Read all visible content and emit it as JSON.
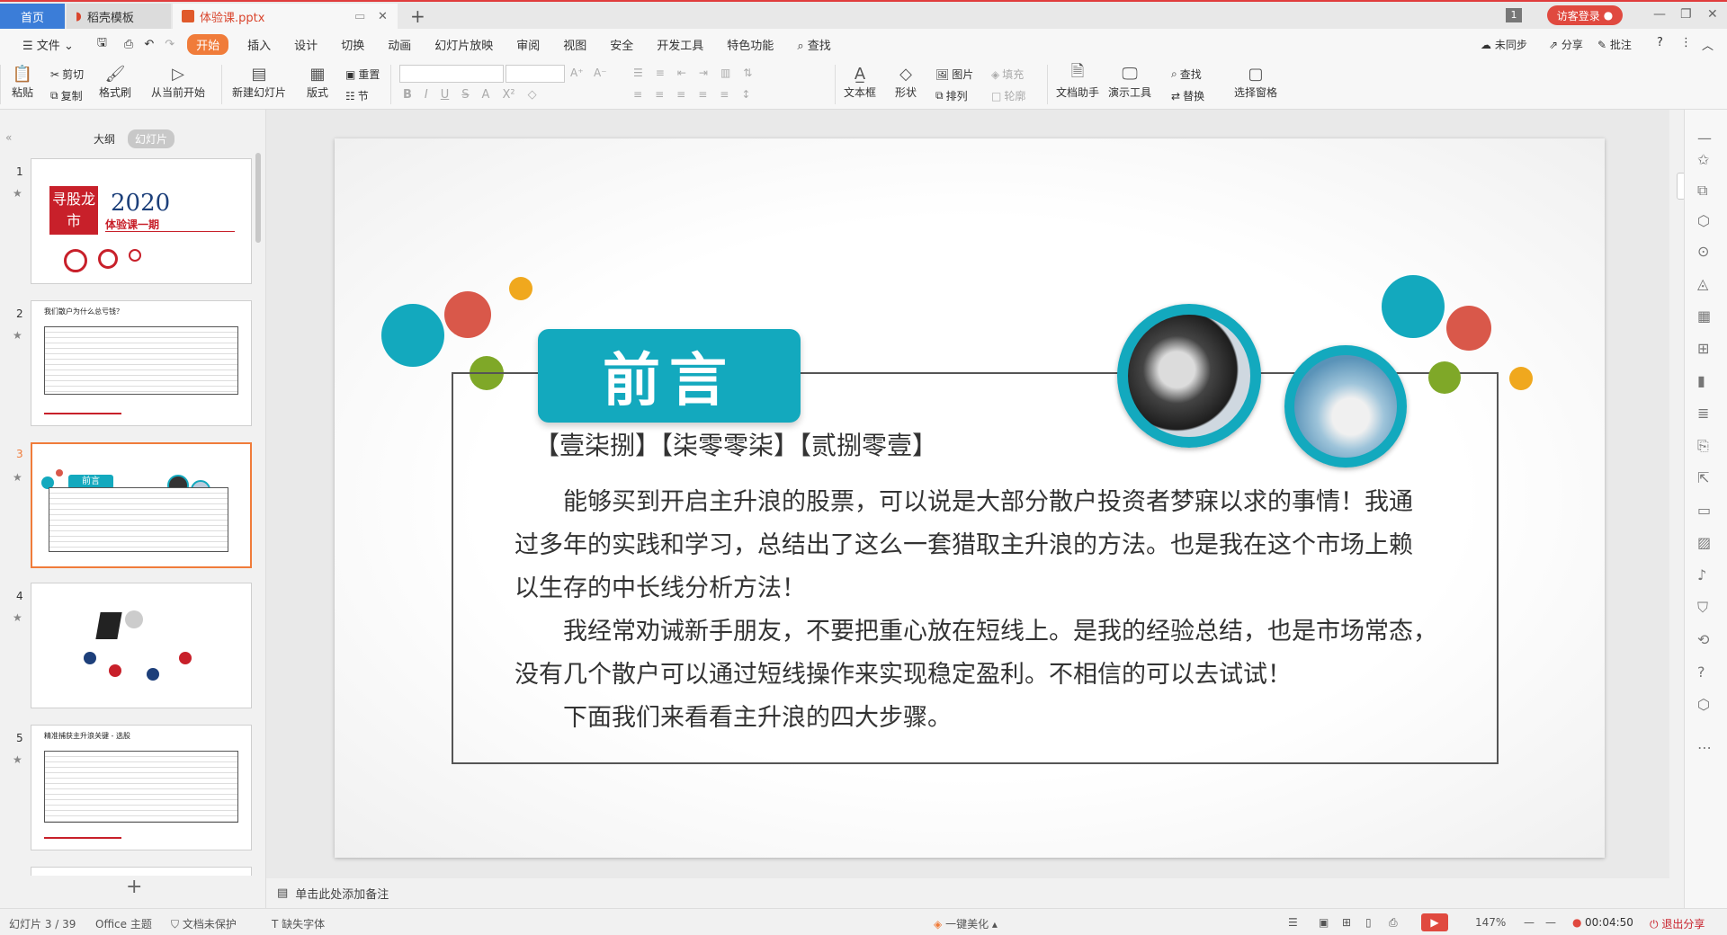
{
  "tabs": {
    "home": "首页",
    "docer": "稻壳模板",
    "file": "体验课.pptx"
  },
  "titlebar": {
    "badge": "1",
    "login": "访客登录"
  },
  "menu": {
    "file": "文件",
    "items": [
      "开始",
      "插入",
      "设计",
      "切换",
      "动画",
      "幻灯片放映",
      "审阅",
      "视图",
      "安全",
      "开发工具",
      "特色功能"
    ],
    "search": "查找",
    "sync": "未同步",
    "share": "分享",
    "comment": "批注"
  },
  "ribbon": {
    "paste": "粘贴",
    "cut": "剪切",
    "copy": "复制",
    "format_painter": "格式刷",
    "from_current": "从当前开始",
    "new_slide": "新建幻灯片",
    "layout": "版式",
    "reset": "重置",
    "section": "节",
    "font_size_up": "A⁺",
    "font_size_down": "A⁻",
    "textbox": "文本框",
    "shape": "形状",
    "picture": "图片",
    "fill": "填充",
    "arrange": "排列",
    "outline": "轮廓",
    "doc_helper": "文档助手",
    "present_tools": "演示工具",
    "find": "查找",
    "replace": "替换",
    "select_pane": "选择窗格"
  },
  "panel": {
    "outline": "大纲",
    "slides": "幻灯片"
  },
  "thumbs": [
    {
      "num": "1",
      "title": "2020",
      "subtitle": "体验课一期",
      "logo": "寻股龙市"
    },
    {
      "num": "2",
      "title": "我们散户为什么总亏钱？"
    },
    {
      "num": "3",
      "title": "前言"
    },
    {
      "num": "4",
      "title": ""
    },
    {
      "num": "5",
      "title": "精准捕获主升浪关键 - 选股"
    }
  ],
  "slide": {
    "title": "前言",
    "subtitle": "【壹柒捌】【柒零零柒】【贰捌零壹】",
    "lines": [
      "能够买到开启主升浪的股票，可以说是大部分散户投资者梦寐以求的事情！我通",
      "过多年的实践和学习，总结出了这么一套猎取主升浪的方法。也是我在这个市场上赖",
      "以生存的中长线分析方法！",
      "我经常劝诫新手朋友，不要把重心放在短线上。是我的经验总结，也是市场常态，",
      "没有几个散户可以通过短线操作来实现稳定盈利。不相信的可以去试试！",
      "下面我们来看看主升浪的四大步骤。"
    ]
  },
  "notes": "单击此处添加备注",
  "status": {
    "slide_count": "幻灯片 3 / 39",
    "theme": "Office 主题",
    "protect": "文档未保护",
    "font": "缺失字体",
    "beautify": "一键美化",
    "zoom": "147%",
    "timer": "00:04:50",
    "exit_share": "退出分享"
  }
}
